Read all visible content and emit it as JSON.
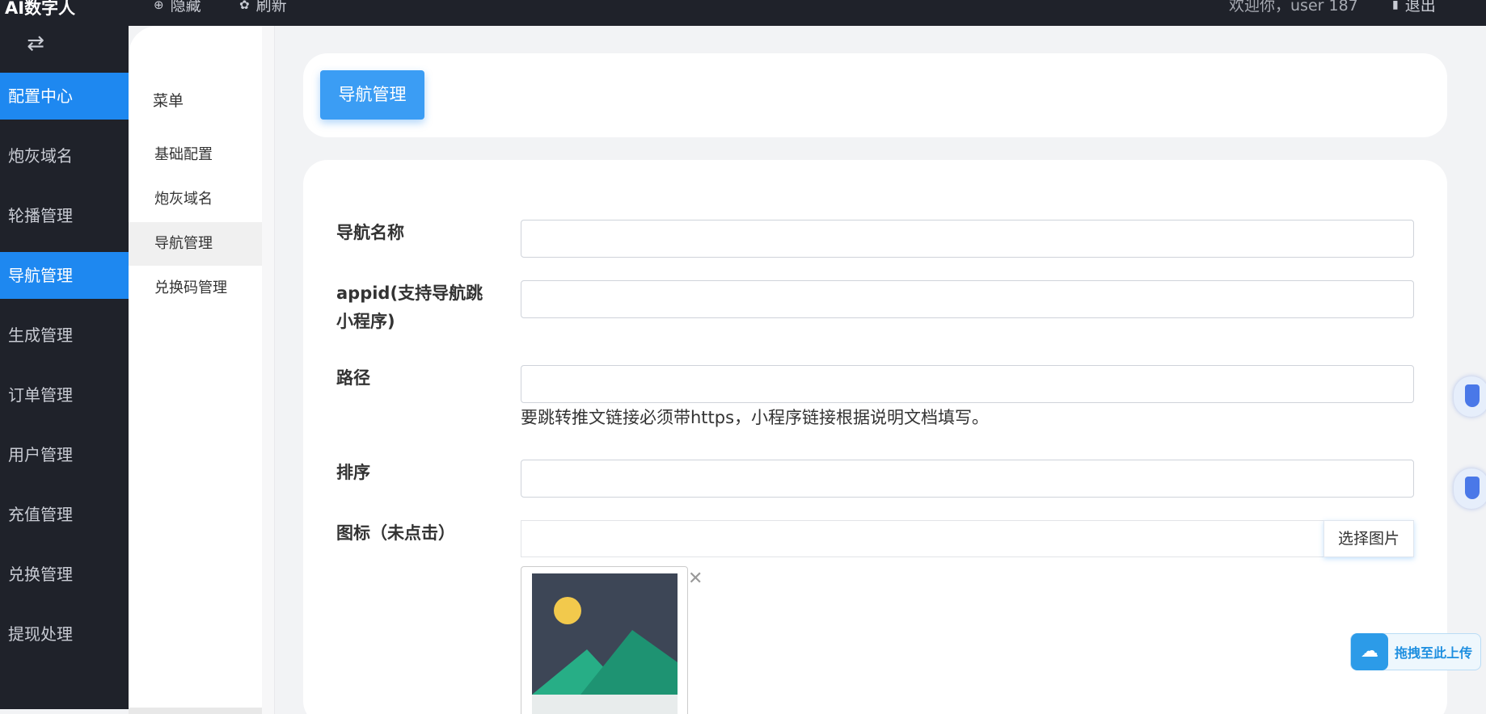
{
  "header": {
    "brand": "AI数字人",
    "hide_label": "隐藏",
    "refresh_label": "刷新",
    "welcome_text": "欢迎你，user 187",
    "logout_label": "退出"
  },
  "sidebar": {
    "items": [
      {
        "label": "配置中心"
      },
      {
        "label": "炮灰域名"
      },
      {
        "label": "轮播管理"
      },
      {
        "label": "导航管理"
      },
      {
        "label": "生成管理"
      },
      {
        "label": "订单管理"
      },
      {
        "label": "用户管理"
      },
      {
        "label": "充值管理"
      },
      {
        "label": "兑换管理"
      },
      {
        "label": "提现处理"
      }
    ],
    "active": [
      "配置中心",
      "导航管理"
    ]
  },
  "submenu": {
    "title": "菜单",
    "items": [
      {
        "label": "基础配置"
      },
      {
        "label": "炮灰域名"
      },
      {
        "label": "导航管理"
      },
      {
        "label": "兑换码管理"
      }
    ],
    "active": "导航管理"
  },
  "page": {
    "tab_label": "导航管理"
  },
  "form": {
    "nav_name_label": "导航名称",
    "appid_label_line1": "appid(支持导航跳",
    "appid_label_line2": "小程序)",
    "path_label": "路径",
    "path_hint": "要跳转推文链接必须带https，小程序链接根据说明文档填写。",
    "sort_label": "排序",
    "icon_label": "图标（未点击）",
    "choose_image_label": "选择图片",
    "nav_name_value": "",
    "appid_value": "",
    "path_value": "",
    "sort_value": "",
    "icon_value": ""
  },
  "widgets": {
    "upload_label": "拖拽至此上传"
  },
  "colors": {
    "accent": "#1e88f0",
    "sidebar_bg": "#1f222a",
    "tab_bg": "#3b9df4"
  }
}
